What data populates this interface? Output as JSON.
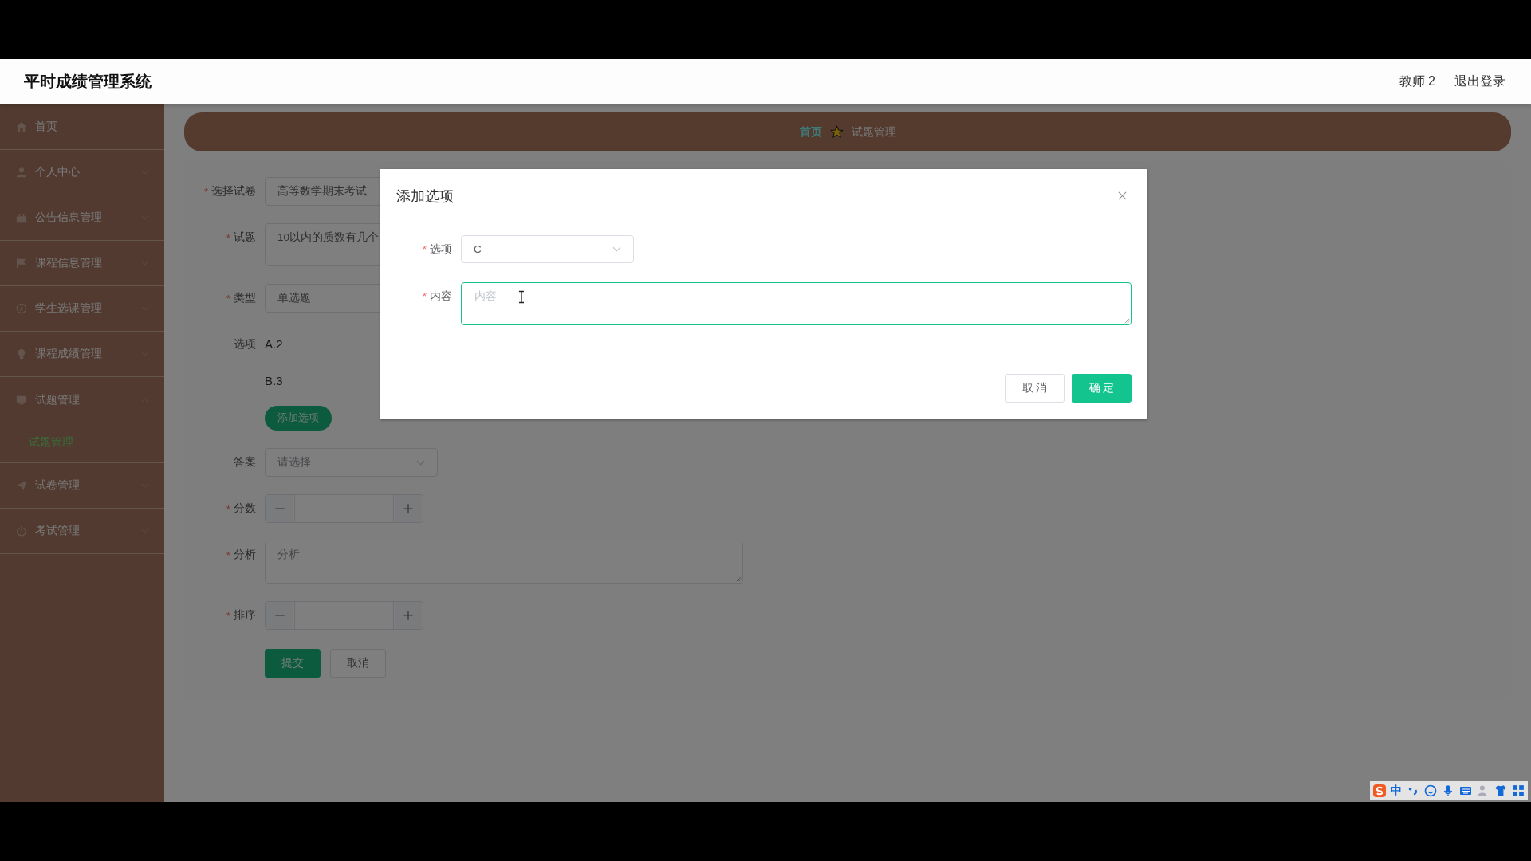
{
  "app": {
    "title": "平时成绩管理系统",
    "user": "教师 2",
    "logout": "退出登录"
  },
  "sidebar": {
    "items": [
      {
        "label": "首页"
      },
      {
        "label": "个人中心",
        "expanded": false
      },
      {
        "label": "公告信息管理",
        "expanded": false
      },
      {
        "label": "课程信息管理",
        "expanded": false
      },
      {
        "label": "学生选课管理",
        "expanded": false
      },
      {
        "label": "课程成绩管理",
        "expanded": false
      },
      {
        "label": "试题管理",
        "expanded": true,
        "children": [
          {
            "label": "试题管理",
            "selected": true
          }
        ]
      },
      {
        "label": "试卷管理",
        "expanded": false
      },
      {
        "label": "考试管理",
        "expanded": false
      }
    ]
  },
  "breadcrumb": [
    {
      "label": "首页",
      "kind": "link"
    },
    {
      "label": "试题管理",
      "kind": "current"
    }
  ],
  "form": {
    "fields": [
      {
        "kind": "input",
        "label": "选择试卷",
        "required_mark": "*",
        "value": "高等数学期末考试"
      },
      {
        "kind": "textarea",
        "label": "试题",
        "required_mark": "*",
        "value": "10以内的质数有几个"
      },
      {
        "kind": "input",
        "label": "类型",
        "required_mark": "*",
        "value": "单选题"
      },
      {
        "kind": "options",
        "label": "选项",
        "options": [
          "A.2",
          "B.3"
        ],
        "button": "添加选项"
      },
      {
        "kind": "select",
        "label": "答案",
        "placeholder": "请选择"
      },
      {
        "kind": "number",
        "label": "分数",
        "required_mark": "*"
      },
      {
        "kind": "textarea",
        "label": "分析",
        "required_mark": "*",
        "placeholder": "分析"
      },
      {
        "kind": "number",
        "label": "排序",
        "required_mark": "*"
      }
    ],
    "buttons": [
      {
        "label": "提交",
        "kind": "primary"
      },
      {
        "label": "取消",
        "kind": "default"
      }
    ]
  },
  "dialog": {
    "title": "添加选项",
    "fields": [
      {
        "kind": "select",
        "label": "选项",
        "required_mark": "*",
        "value": "C"
      },
      {
        "kind": "textarea",
        "label": "内容",
        "required_mark": "*",
        "placeholder": "内容",
        "focused": true
      }
    ],
    "buttons": [
      {
        "label": "取 消",
        "kind": "default"
      },
      {
        "label": "确 定",
        "kind": "primary"
      }
    ]
  },
  "ime": {
    "mode": "中"
  }
}
